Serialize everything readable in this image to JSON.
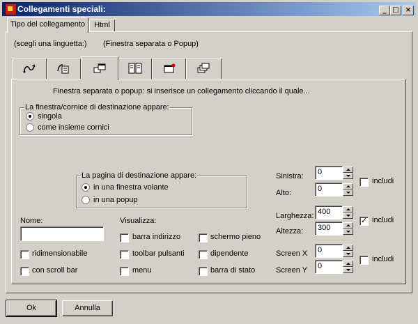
{
  "window": {
    "title": "Collegamenti speciali:",
    "controls": {
      "minimize": "_",
      "maximize": "□",
      "close": "×"
    }
  },
  "top_tabs": [
    "Tipo del collegamento",
    "Html"
  ],
  "hint": {
    "choose": "(scegli una linguetta:)",
    "selected": "(Finestra separata o Popup)"
  },
  "icon_tabs": [
    {
      "icon": "link-arrows-icon"
    },
    {
      "icon": "frame-link-icon"
    },
    {
      "icon": "popup-window-icon"
    },
    {
      "icon": "frames-grid-icon"
    },
    {
      "icon": "window-target-icon"
    },
    {
      "icon": "layered-windows-icon"
    }
  ],
  "description": "Finestra separata o popup: si inserisce un collegamento cliccando il quale...",
  "frame_group": {
    "legend": "La finestra/cornice di destinazione appare:",
    "options": [
      {
        "label": "singola",
        "selected": true
      },
      {
        "label": "come insieme cornici",
        "selected": false
      }
    ]
  },
  "page_group": {
    "legend": "La pagina di destinazione appare:",
    "options": [
      {
        "label": "in una finestra volante",
        "selected": true
      },
      {
        "label": "in una popup",
        "selected": false
      }
    ]
  },
  "position": {
    "left_label": "Sinistra:",
    "left_value": "0",
    "top_label": "Alto:",
    "top_value": "0",
    "include_label": "includi",
    "include_checked": false
  },
  "size": {
    "width_label": "Larghezza:",
    "width_value": "400",
    "height_label": "Altezza:",
    "height_value": "300",
    "include_label": "includi",
    "include_checked": true
  },
  "screen": {
    "x_label": "Screen X",
    "x_value": "0",
    "y_label": "Screen Y",
    "y_value": "0",
    "include_label": "includi",
    "include_checked": false
  },
  "name": {
    "label": "Nome:",
    "value": ""
  },
  "options_left": [
    {
      "label": "ridimensionabile",
      "checked": false
    },
    {
      "label": "con scroll bar",
      "checked": false
    }
  ],
  "visualizza": {
    "label": "Visualizza:",
    "col1": [
      {
        "label": "barra indirizzo",
        "checked": false
      },
      {
        "label": "toolbar pulsanti",
        "checked": false
      },
      {
        "label": "menu",
        "checked": false
      }
    ],
    "col2": [
      {
        "label": "schermo pieno",
        "checked": false
      },
      {
        "label": "dipendente",
        "checked": false
      },
      {
        "label": "barra di stato",
        "checked": false
      }
    ]
  },
  "buttons": {
    "ok": "Ok",
    "cancel": "Annulla"
  }
}
